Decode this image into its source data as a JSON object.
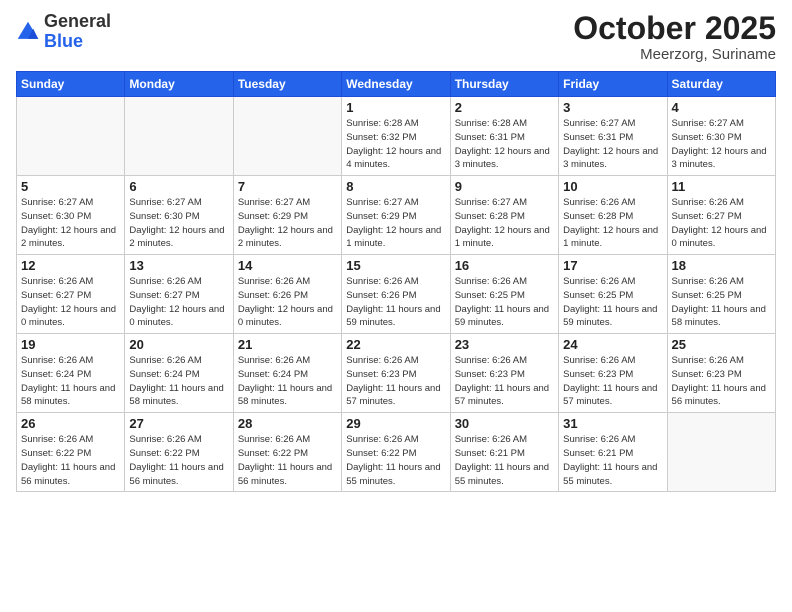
{
  "header": {
    "logo_general": "General",
    "logo_blue": "Blue",
    "month": "October 2025",
    "location": "Meerzorg, Suriname"
  },
  "weekdays": [
    "Sunday",
    "Monday",
    "Tuesday",
    "Wednesday",
    "Thursday",
    "Friday",
    "Saturday"
  ],
  "weeks": [
    [
      {
        "day": "",
        "info": ""
      },
      {
        "day": "",
        "info": ""
      },
      {
        "day": "",
        "info": ""
      },
      {
        "day": "1",
        "info": "Sunrise: 6:28 AM\nSunset: 6:32 PM\nDaylight: 12 hours\nand 4 minutes."
      },
      {
        "day": "2",
        "info": "Sunrise: 6:28 AM\nSunset: 6:31 PM\nDaylight: 12 hours\nand 3 minutes."
      },
      {
        "day": "3",
        "info": "Sunrise: 6:27 AM\nSunset: 6:31 PM\nDaylight: 12 hours\nand 3 minutes."
      },
      {
        "day": "4",
        "info": "Sunrise: 6:27 AM\nSunset: 6:30 PM\nDaylight: 12 hours\nand 3 minutes."
      }
    ],
    [
      {
        "day": "5",
        "info": "Sunrise: 6:27 AM\nSunset: 6:30 PM\nDaylight: 12 hours\nand 2 minutes."
      },
      {
        "day": "6",
        "info": "Sunrise: 6:27 AM\nSunset: 6:30 PM\nDaylight: 12 hours\nand 2 minutes."
      },
      {
        "day": "7",
        "info": "Sunrise: 6:27 AM\nSunset: 6:29 PM\nDaylight: 12 hours\nand 2 minutes."
      },
      {
        "day": "8",
        "info": "Sunrise: 6:27 AM\nSunset: 6:29 PM\nDaylight: 12 hours\nand 1 minute."
      },
      {
        "day": "9",
        "info": "Sunrise: 6:27 AM\nSunset: 6:28 PM\nDaylight: 12 hours\nand 1 minute."
      },
      {
        "day": "10",
        "info": "Sunrise: 6:26 AM\nSunset: 6:28 PM\nDaylight: 12 hours\nand 1 minute."
      },
      {
        "day": "11",
        "info": "Sunrise: 6:26 AM\nSunset: 6:27 PM\nDaylight: 12 hours\nand 0 minutes."
      }
    ],
    [
      {
        "day": "12",
        "info": "Sunrise: 6:26 AM\nSunset: 6:27 PM\nDaylight: 12 hours\nand 0 minutes."
      },
      {
        "day": "13",
        "info": "Sunrise: 6:26 AM\nSunset: 6:27 PM\nDaylight: 12 hours\nand 0 minutes."
      },
      {
        "day": "14",
        "info": "Sunrise: 6:26 AM\nSunset: 6:26 PM\nDaylight: 12 hours\nand 0 minutes."
      },
      {
        "day": "15",
        "info": "Sunrise: 6:26 AM\nSunset: 6:26 PM\nDaylight: 11 hours\nand 59 minutes."
      },
      {
        "day": "16",
        "info": "Sunrise: 6:26 AM\nSunset: 6:25 PM\nDaylight: 11 hours\nand 59 minutes."
      },
      {
        "day": "17",
        "info": "Sunrise: 6:26 AM\nSunset: 6:25 PM\nDaylight: 11 hours\nand 59 minutes."
      },
      {
        "day": "18",
        "info": "Sunrise: 6:26 AM\nSunset: 6:25 PM\nDaylight: 11 hours\nand 58 minutes."
      }
    ],
    [
      {
        "day": "19",
        "info": "Sunrise: 6:26 AM\nSunset: 6:24 PM\nDaylight: 11 hours\nand 58 minutes."
      },
      {
        "day": "20",
        "info": "Sunrise: 6:26 AM\nSunset: 6:24 PM\nDaylight: 11 hours\nand 58 minutes."
      },
      {
        "day": "21",
        "info": "Sunrise: 6:26 AM\nSunset: 6:24 PM\nDaylight: 11 hours\nand 58 minutes."
      },
      {
        "day": "22",
        "info": "Sunrise: 6:26 AM\nSunset: 6:23 PM\nDaylight: 11 hours\nand 57 minutes."
      },
      {
        "day": "23",
        "info": "Sunrise: 6:26 AM\nSunset: 6:23 PM\nDaylight: 11 hours\nand 57 minutes."
      },
      {
        "day": "24",
        "info": "Sunrise: 6:26 AM\nSunset: 6:23 PM\nDaylight: 11 hours\nand 57 minutes."
      },
      {
        "day": "25",
        "info": "Sunrise: 6:26 AM\nSunset: 6:23 PM\nDaylight: 11 hours\nand 56 minutes."
      }
    ],
    [
      {
        "day": "26",
        "info": "Sunrise: 6:26 AM\nSunset: 6:22 PM\nDaylight: 11 hours\nand 56 minutes."
      },
      {
        "day": "27",
        "info": "Sunrise: 6:26 AM\nSunset: 6:22 PM\nDaylight: 11 hours\nand 56 minutes."
      },
      {
        "day": "28",
        "info": "Sunrise: 6:26 AM\nSunset: 6:22 PM\nDaylight: 11 hours\nand 56 minutes."
      },
      {
        "day": "29",
        "info": "Sunrise: 6:26 AM\nSunset: 6:22 PM\nDaylight: 11 hours\nand 55 minutes."
      },
      {
        "day": "30",
        "info": "Sunrise: 6:26 AM\nSunset: 6:21 PM\nDaylight: 11 hours\nand 55 minutes."
      },
      {
        "day": "31",
        "info": "Sunrise: 6:26 AM\nSunset: 6:21 PM\nDaylight: 11 hours\nand 55 minutes."
      },
      {
        "day": "",
        "info": ""
      }
    ]
  ]
}
